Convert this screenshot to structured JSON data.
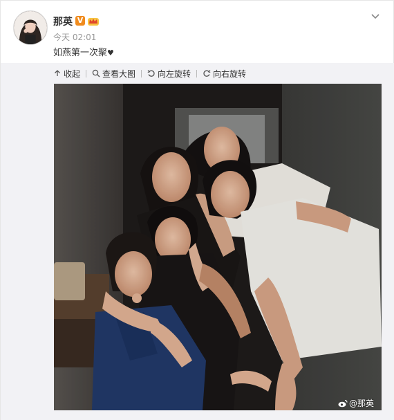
{
  "post": {
    "author_name": "那英",
    "timestamp": "今天 02:01",
    "text": "如燕第一次聚",
    "text_suffix": "♥",
    "verified_badge": "V"
  },
  "toolbar": {
    "collapse_label": "收起",
    "view_large_label": "查看大图",
    "rotate_left_label": "向左旋转",
    "rotate_right_label": "向右旋转"
  },
  "photo": {
    "watermark": "@那英"
  },
  "icons": {
    "collapse": "arrow-up-icon",
    "view_large": "magnifier-icon",
    "rotate_left": "rotate-left-icon",
    "rotate_right": "rotate-right-icon",
    "more": "chevron-down-icon",
    "weibo": "weibo-logo-icon"
  },
  "colors": {
    "verified_badge": "#f08b1d",
    "panel_bg": "#f2f2f5"
  }
}
